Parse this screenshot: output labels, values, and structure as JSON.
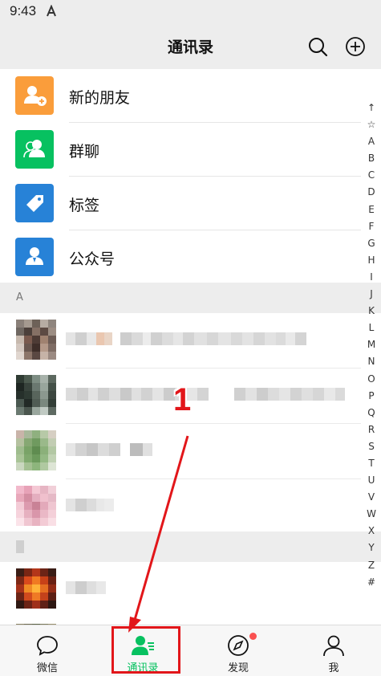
{
  "status_bar": {
    "time": "9:43"
  },
  "header": {
    "title": "通讯录"
  },
  "functions": [
    {
      "label": "新的朋友",
      "color": "#fa9d3b",
      "icon": "add-friend-icon"
    },
    {
      "label": "群聊",
      "color": "#07c160",
      "icon": "group-chat-icon"
    },
    {
      "label": "标签",
      "color": "#2782d7",
      "icon": "tag-icon"
    },
    {
      "label": "公众号",
      "color": "#2782d7",
      "icon": "official-account-icon"
    }
  ],
  "sections": [
    {
      "letter": "A"
    },
    {
      "letter": ""
    }
  ],
  "index_letters": [
    "↑",
    "☆",
    "A",
    "B",
    "C",
    "D",
    "E",
    "F",
    "G",
    "H",
    "I",
    "J",
    "K",
    "L",
    "M",
    "N",
    "O",
    "P",
    "Q",
    "R",
    "S",
    "T",
    "U",
    "V",
    "W",
    "X",
    "Y",
    "Z",
    "#"
  ],
  "tabs": [
    {
      "label": "微信",
      "icon": "chat-bubble-icon"
    },
    {
      "label": "通讯录",
      "icon": "contacts-icon"
    },
    {
      "label": "发现",
      "icon": "compass-icon"
    },
    {
      "label": "我",
      "icon": "person-icon"
    }
  ],
  "annotation": {
    "number": "1",
    "color": "#e2161a"
  },
  "colors": {
    "brand_green": "#07c160",
    "background": "#ededed"
  }
}
